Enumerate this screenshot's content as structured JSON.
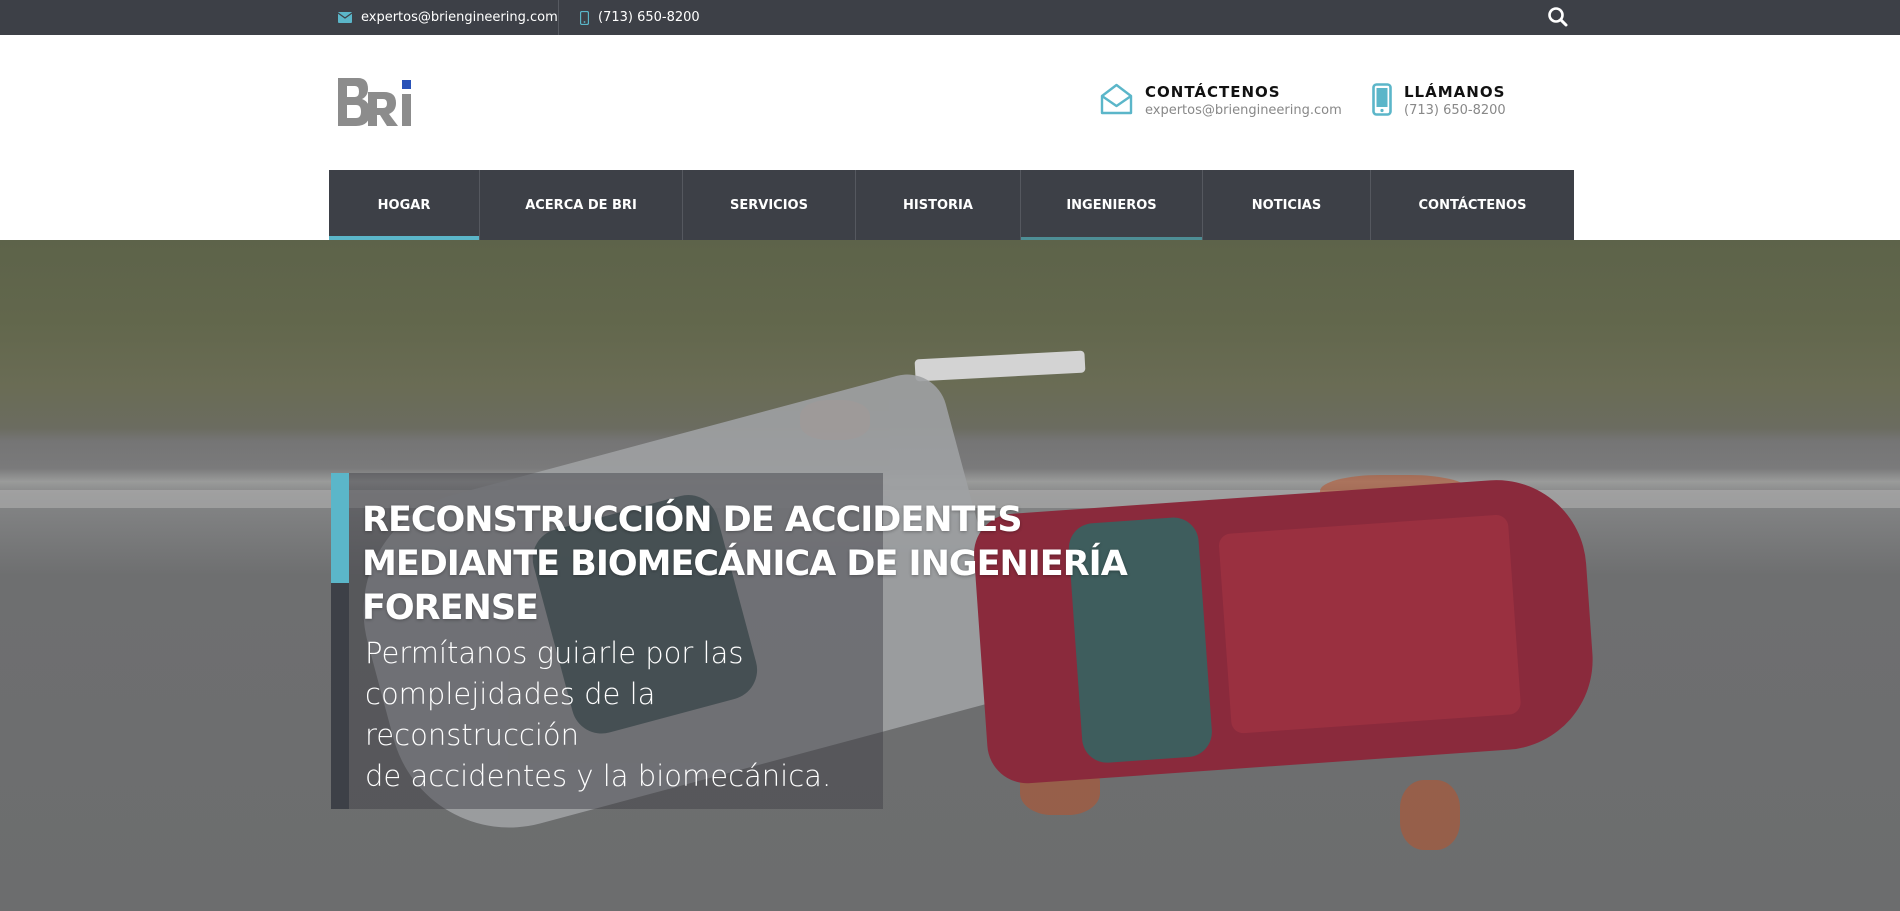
{
  "topbar": {
    "email": "expertos@briengineering.com",
    "phone": "(713) 650-8200",
    "icons": {
      "email": "envelope-icon",
      "phone": "mobile-phone-icon",
      "search": "search-icon"
    }
  },
  "header": {
    "logo_text": "BRi",
    "contact": {
      "title": "CONTÁCTENOS",
      "subtitle": "expertos@briengineering.com",
      "icon": "open-envelope-icon"
    },
    "call": {
      "title": "LLÁMANOS",
      "subtitle": "(713) 650-8200",
      "icon": "smartphone-icon"
    }
  },
  "nav": {
    "items": [
      {
        "label": "HOGAR",
        "state": "active"
      },
      {
        "label": "ACERCA DE BRI",
        "state": ""
      },
      {
        "label": "SERVICIOS",
        "state": ""
      },
      {
        "label": "HISTORIA",
        "state": ""
      },
      {
        "label": "INGENIEROS",
        "state": "highlight"
      },
      {
        "label": "NOTICIAS",
        "state": ""
      },
      {
        "label": "CONTÁCTENOS",
        "state": ""
      }
    ]
  },
  "hero": {
    "title_line1": "RECONSTRUCCIÓN DE ACCIDENTES",
    "title_line2": "MEDIANTE BIOMECÁNICA DE INGENIERÍA FORENSE",
    "subtitle_line1": "Permítanos guiarle por las",
    "subtitle_line2": "complejidades de la reconstrucción",
    "subtitle_line3": "de accidentes y la biomecánica."
  },
  "colors": {
    "dark": "#3d4047",
    "accent": "#5bb6c9",
    "accent_dark": "#4e8e95"
  }
}
